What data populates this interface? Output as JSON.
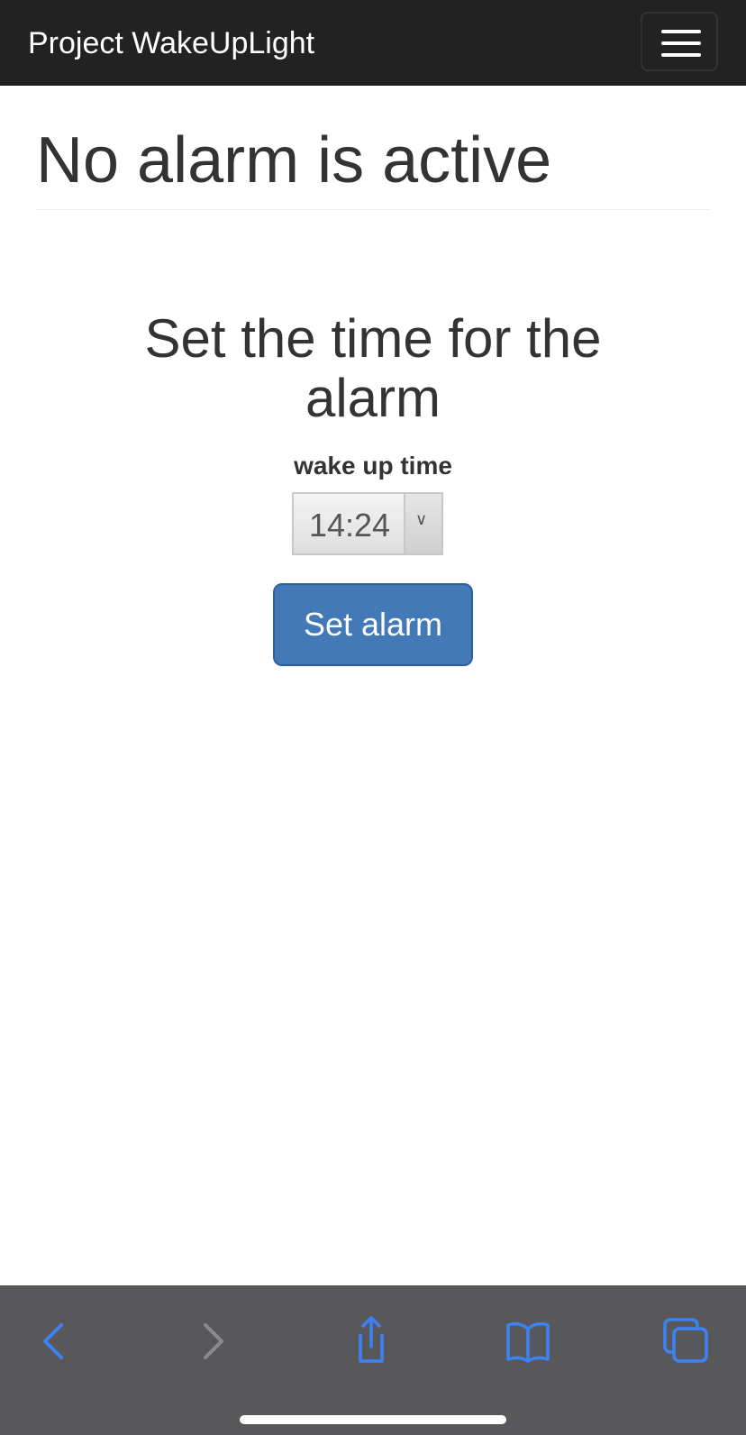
{
  "navbar": {
    "brand": "Project WakeUpLight",
    "menu_icon": "hamburger-menu-icon"
  },
  "status": {
    "title": "No alarm is active"
  },
  "alarm_form": {
    "title": "Set the time for the alarm",
    "time_label": "wake up time",
    "time_value": "14:24",
    "submit_label": "Set alarm"
  },
  "browser_toolbar": {
    "icons": [
      "back-icon",
      "forward-icon",
      "share-icon",
      "bookmarks-icon",
      "tabs-icon"
    ]
  },
  "colors": {
    "navbar_bg": "#222222",
    "primary_button": "#4479b7",
    "toolbar_bg": "#58585a",
    "toolbar_icon_active": "#3b82f6",
    "toolbar_icon_disabled": "#8a8a8e"
  }
}
